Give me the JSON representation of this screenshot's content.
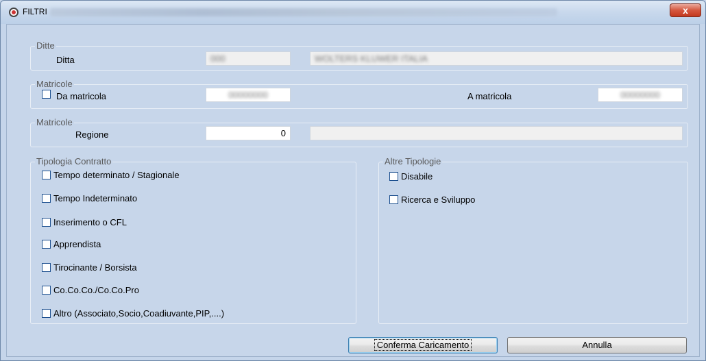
{
  "window": {
    "title": "FILTRI",
    "close_glyph": "x",
    "title_icon": "radio-icon"
  },
  "ditte": {
    "legend": "Ditte",
    "ditta_label": "Ditta",
    "code_value": "000",
    "name_value": "WOLTERS KLUWER ITALIA"
  },
  "matricole1": {
    "legend": "Matricole",
    "da_label": "Da matricola",
    "da_value": "00000000",
    "a_label": "A matricola",
    "a_value": "00000000",
    "checked": false
  },
  "matricole2": {
    "legend": "Matricole",
    "regione_label": "Regione",
    "regione_value": "0",
    "regione_desc": ""
  },
  "tipologia": {
    "legend": "Tipologia Contratto",
    "items": [
      {
        "label": "Tempo determinato / Stagionale",
        "checked": false
      },
      {
        "label": "Tempo Indeterminato",
        "checked": false
      },
      {
        "label": "Inserimento o CFL",
        "checked": false
      },
      {
        "label": "Apprendista",
        "checked": false
      },
      {
        "label": "Tirocinante / Borsista",
        "checked": false
      },
      {
        "label": "Co.Co.Co./Co.Co.Pro",
        "checked": false
      },
      {
        "label": "Altro (Associato,Socio,Coadiuvante,PIP,....)",
        "checked": false
      }
    ]
  },
  "altre": {
    "legend": "Altre Tipologie",
    "items": [
      {
        "label": "Disabile",
        "checked": false
      },
      {
        "label": "Ricerca e Sviluppo",
        "checked": false
      }
    ]
  },
  "buttons": {
    "confirm_label": "Conferma Caricamento",
    "cancel_label": "Annulla"
  }
}
